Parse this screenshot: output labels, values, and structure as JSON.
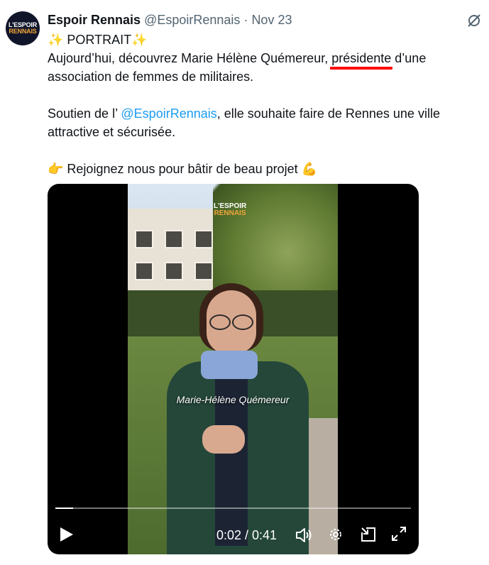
{
  "tweet": {
    "author_name": "Espoir Rennais",
    "handle": "@EspoirRennais",
    "separator": "·",
    "date": "Nov 23",
    "avatar_logo": {
      "line1": "L'ESPOIR",
      "line2": "RENNAIS"
    },
    "line1": "✨ PORTRAIT✨",
    "line2_before": "Aujourd’hui, découvrez Marie Hélène Quémereur, ",
    "line2_highlight": "présidente",
    "line2_after": " d’une",
    "line3": "association de femmes de militaires.",
    "line4_before": "Soutien de l’ ",
    "line4_mention": "@EspoirRennais",
    "line4_after": ", elle souhaite faire de Rennes une ville",
    "line5": "attractive et sécurisée.",
    "line6_emoji": "👉",
    "line6_text": " Rejoignez nous pour bâtir de beau projet ",
    "line6_emoji2": "💪"
  },
  "video": {
    "logo": {
      "line1": "L'ESPOIR",
      "line2": "RENNAIS"
    },
    "caption": "Marie-Hélène Quémereur",
    "time": "0:02 / 0:41",
    "progress": 0.05
  },
  "colors": {
    "link": "#1d9bf0",
    "highlight_underline": "#ff0000",
    "secondary": "#536471"
  },
  "icons": [
    "grok-icon",
    "play-icon",
    "volume-icon",
    "settings-icon",
    "picture-in-picture-icon",
    "fullscreen-icon"
  ]
}
